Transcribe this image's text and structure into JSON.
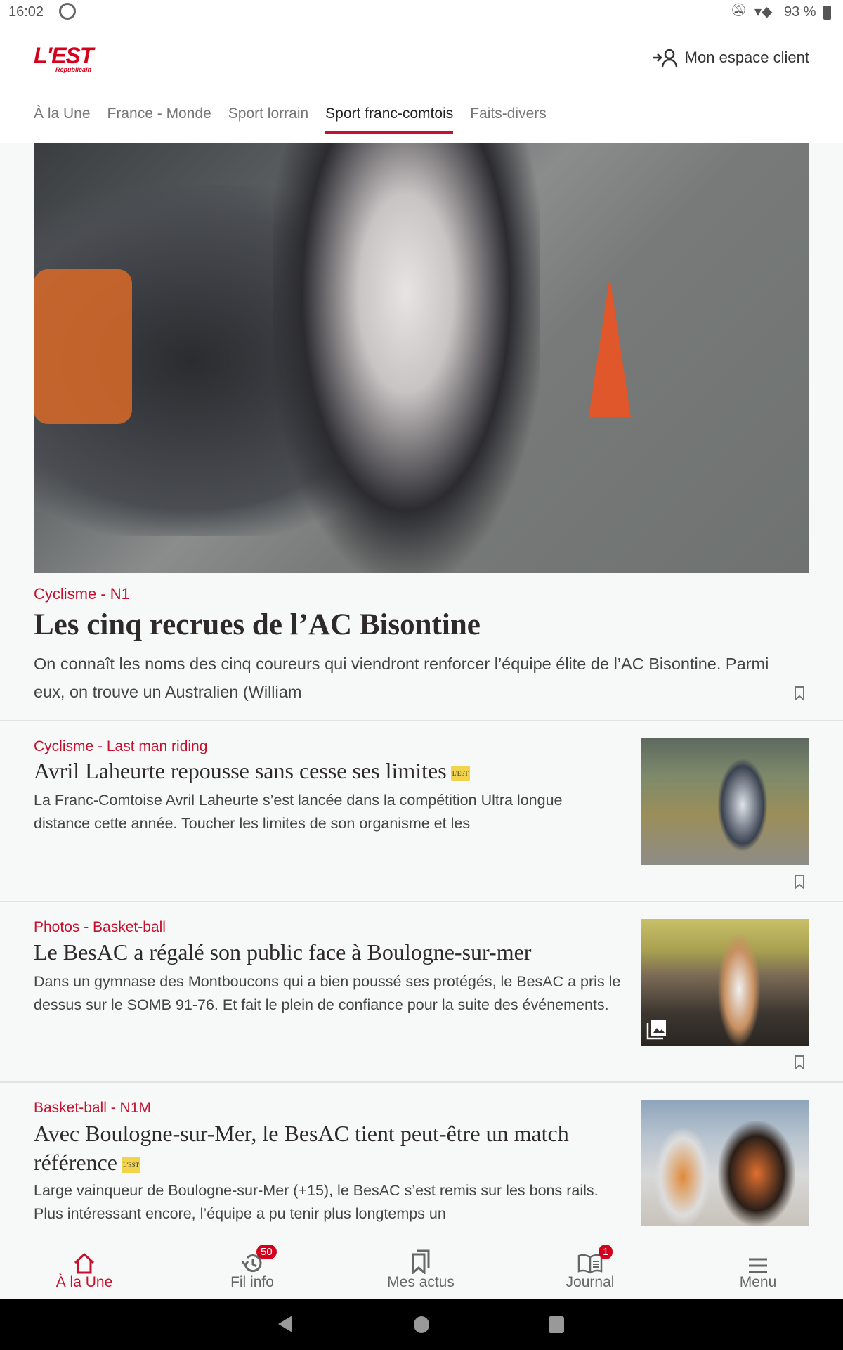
{
  "status": {
    "time": "16:02",
    "battery": "93 %"
  },
  "header": {
    "logo": "L'EST Républicain",
    "account_label": "Mon espace client"
  },
  "tabs": [
    {
      "label": "À la Une"
    },
    {
      "label": "France - Monde"
    },
    {
      "label": "Sport lorrain"
    },
    {
      "label": "Sport franc-comtois",
      "active": true
    },
    {
      "label": "Faits-divers"
    }
  ],
  "hero": {
    "category": "Cyclisme - N1",
    "title": "Les cinq recrues de l’AC Bisontine",
    "summary": "On connaît les noms des cinq coureurs qui viendront renforcer l’équipe élite de l’AC Bisontine. Parmi eux, on trouve un Australien (William"
  },
  "articles": [
    {
      "category": "Cyclisme - Last man riding",
      "title": "Avril Laheurte repousse sans cesse ses limites",
      "premium": "L'EST",
      "summary": "La Franc-Comtoise Avril Laheurte s’est lancée dans la compétition Ultra longue distance cette année. Toucher les limites de son organisme et les"
    },
    {
      "category": "Photos - Basket-ball",
      "title": "Le BesAC a régalé son public face à Boulogne-sur-mer",
      "summary": "Dans un gymnase des Montboucons qui a bien poussé ses protégés, le BesAC a pris le dessus sur le SOMB 91-76. Et fait le plein de confiance pour la suite des événements."
    },
    {
      "category": "Basket-ball - N1M",
      "title": "Avec Boulogne-sur-Mer, le BesAC tient peut-être un match référence",
      "premium": "L'EST",
      "summary": "Large vainqueur de Boulogne-sur-Mer (+15), le BesAC s’est remis sur les bons rails. Plus intéressant encore, l’équipe a pu tenir plus longtemps un"
    }
  ],
  "bottom_nav": [
    {
      "label": "À la Une",
      "icon": "home-icon",
      "active": true
    },
    {
      "label": "Fil info",
      "icon": "history-icon",
      "badge": "50"
    },
    {
      "label": "Mes actus",
      "icon": "bookmarks-icon"
    },
    {
      "label": "Journal",
      "icon": "newspaper-icon",
      "badge": "1"
    },
    {
      "label": "Menu",
      "icon": "menu-icon"
    }
  ],
  "colors": {
    "accent": "#c8102e",
    "premium_badge": "#f2d34c"
  }
}
